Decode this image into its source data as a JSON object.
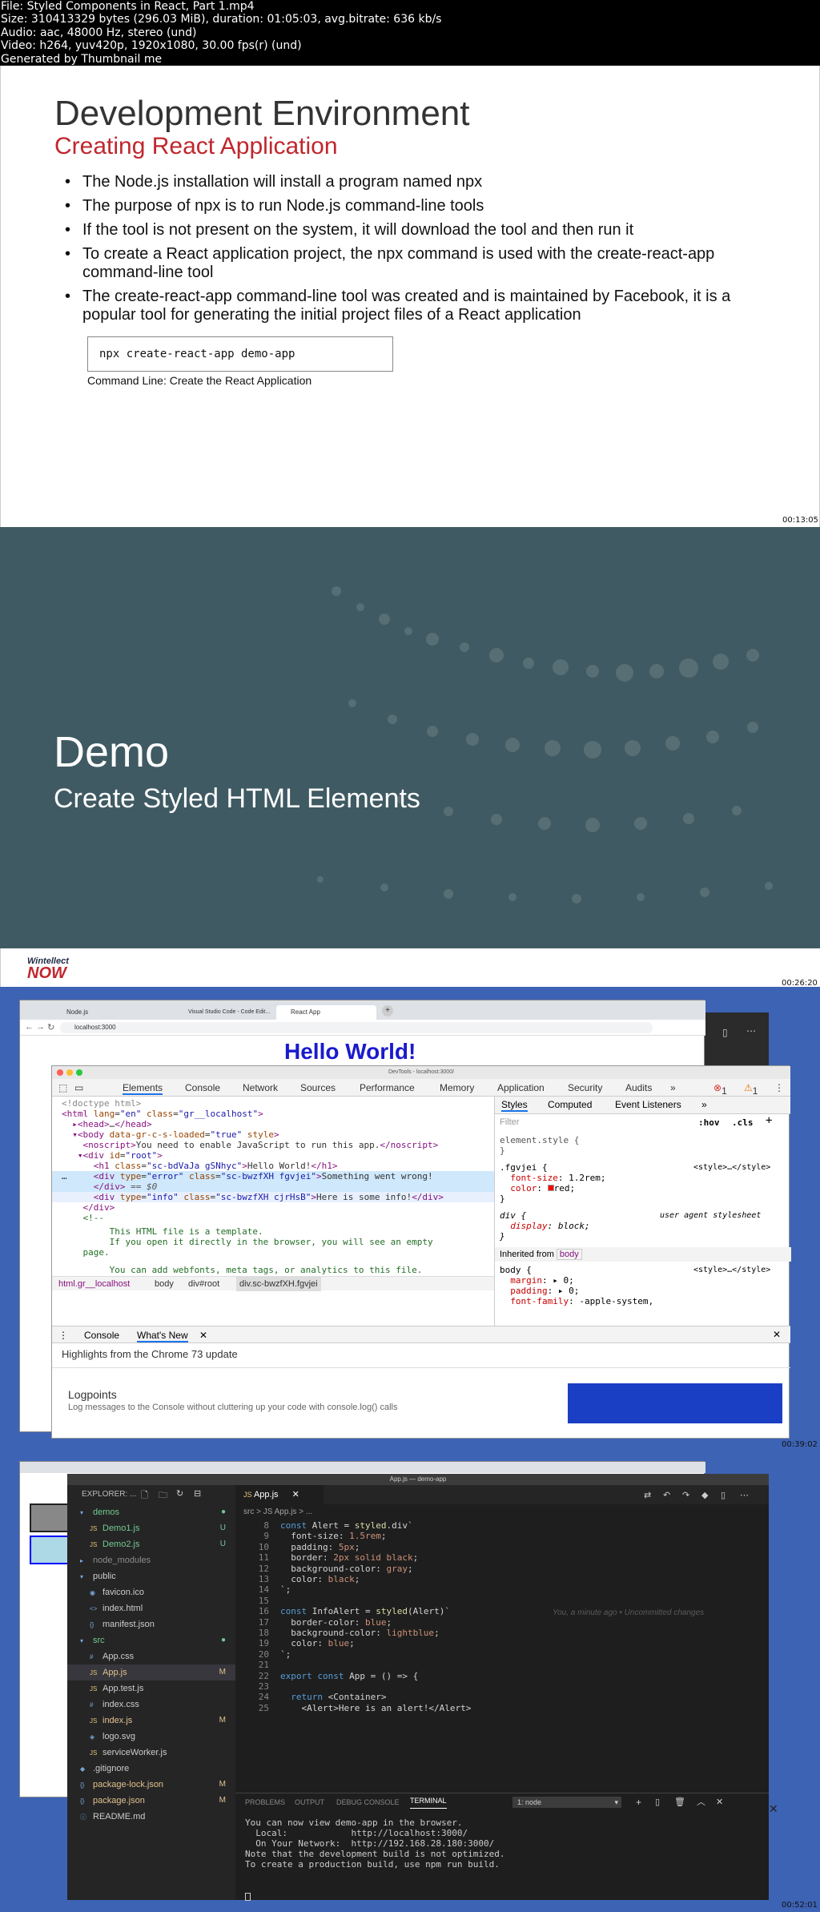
{
  "info": {
    "lines": [
      "File: Styled Components in React, Part 1.mp4",
      "Size: 310413329 bytes (296.03 MiB), duration: 01:05:03, avg.bitrate: 636 kb/s",
      "Audio: aac, 48000 Hz, stereo (und)",
      "Video: h264, yuv420p, 1920x1080, 30.00 fps(r) (und)",
      "Generated by Thumbnail me"
    ]
  },
  "slide1": {
    "title": "Development Environment",
    "subtitle": "Creating React Application",
    "bullets": [
      "The Node.js installation will install a program named npx",
      "The purpose of npx is to run Node.js command-line tools",
      "If the tool is not present on the system, it will download the tool and then run it",
      "To create a React application project, the npx command is used with the create-react-app command-line tool",
      "The create-react-app command-line tool was created and is maintained by Facebook, it is a popular tool for generating the initial project files of a React application"
    ],
    "code": "npx create-react-app demo-app",
    "caption": "Command Line: Create the React Application",
    "timestamp": "00:13:05"
  },
  "slide2": {
    "title": "Demo",
    "subtitle": "Create Styled HTML Elements",
    "brand_top": "Wintellect",
    "brand_bottom": "NOW",
    "timestamp": "00:26:20"
  },
  "frame3": {
    "tabs": [
      "Node.js",
      "Visual Studio Code - Code Edit...",
      "React App"
    ],
    "url": "localhost:3000",
    "page_heading": "Hello World!",
    "devtools_title": "DevTools - localhost:3000/",
    "dt_tabs": [
      "Elements",
      "Console",
      "Network",
      "Sources",
      "Performance",
      "Memory",
      "Application",
      "Security",
      "Audits",
      "»"
    ],
    "errors": "1",
    "warnings": "1",
    "styles_tabs": [
      "Styles",
      "Computed",
      "Event Listeners",
      "»"
    ],
    "filter_placeholder": "Filter",
    "hov": ":hov",
    "cls": ".cls",
    "breadcrumb": [
      "html.gr__localhost",
      "body",
      "div#root",
      "div.sc-bwzfXH.fgvjei"
    ],
    "drawer_tabs": [
      "Console",
      "What's New"
    ],
    "drawer_headline": "Highlights from the Chrome 73 update",
    "drawer_item": "Logpoints",
    "drawer_item_desc": "Log messages to the Console without cluttering up your code with console.log() calls",
    "timestamp": "00:39:02"
  },
  "frame4": {
    "window_title": "App.js — demo-app",
    "explorer_title": "EXPLORER: ...",
    "file_tab": "App.js",
    "breadcrumb": "src > JS App.js > ...",
    "tree": [
      {
        "name": "demos",
        "indent": 1,
        "type": "folder-open",
        "color": "#73c991",
        "badge": "●"
      },
      {
        "name": "Demo1.js",
        "indent": 2,
        "type": "js",
        "color": "#73c991",
        "badge": "U"
      },
      {
        "name": "Demo2.js",
        "indent": 2,
        "type": "js",
        "color": "#73c991",
        "badge": "U"
      },
      {
        "name": "node_modules",
        "indent": 1,
        "type": "folder",
        "color": "#8c8c8c",
        "badge": ""
      },
      {
        "name": "public",
        "indent": 1,
        "type": "folder-open",
        "color": "#cccccc",
        "badge": ""
      },
      {
        "name": "favicon.ico",
        "indent": 2,
        "type": "ico",
        "color": "#cccccc",
        "badge": ""
      },
      {
        "name": "index.html",
        "indent": 2,
        "type": "html",
        "color": "#cccccc",
        "badge": ""
      },
      {
        "name": "manifest.json",
        "indent": 2,
        "type": "json",
        "color": "#cccccc",
        "badge": ""
      },
      {
        "name": "src",
        "indent": 1,
        "type": "folder-open",
        "color": "#73c991",
        "badge": "●"
      },
      {
        "name": "App.css",
        "indent": 2,
        "type": "css",
        "color": "#cccccc",
        "badge": ""
      },
      {
        "name": "App.js",
        "indent": 2,
        "type": "js",
        "color": "#e2c08d",
        "badge": "M"
      },
      {
        "name": "App.test.js",
        "indent": 2,
        "type": "js",
        "color": "#cccccc",
        "badge": ""
      },
      {
        "name": "index.css",
        "indent": 2,
        "type": "css",
        "color": "#cccccc",
        "badge": ""
      },
      {
        "name": "index.js",
        "indent": 2,
        "type": "js",
        "color": "#e2c08d",
        "badge": "M"
      },
      {
        "name": "logo.svg",
        "indent": 2,
        "type": "svg",
        "color": "#cccccc",
        "badge": ""
      },
      {
        "name": "serviceWorker.js",
        "indent": 2,
        "type": "js",
        "color": "#cccccc",
        "badge": ""
      },
      {
        "name": ".gitignore",
        "indent": 1,
        "type": "git",
        "color": "#cccccc",
        "badge": ""
      },
      {
        "name": "package-lock.json",
        "indent": 1,
        "type": "json",
        "color": "#e2c08d",
        "badge": "M"
      },
      {
        "name": "package.json",
        "indent": 1,
        "type": "json",
        "color": "#e2c08d",
        "badge": "M"
      },
      {
        "name": "README.md",
        "indent": 1,
        "type": "md",
        "color": "#cccccc",
        "badge": ""
      }
    ],
    "code_lines": [
      {
        "n": "8",
        "t": "const Alert = styled.div`"
      },
      {
        "n": "9",
        "t": "  font-size: 1.5rem;"
      },
      {
        "n": "10",
        "t": "  padding: 5px;"
      },
      {
        "n": "11",
        "t": "  border: 2px solid black;"
      },
      {
        "n": "12",
        "t": "  background-color: gray;"
      },
      {
        "n": "13",
        "t": "  color: black;"
      },
      {
        "n": "14",
        "t": "`;"
      },
      {
        "n": "15",
        "t": ""
      },
      {
        "n": "16",
        "t": "const InfoAlert = styled(Alert)`"
      },
      {
        "n": "17",
        "t": "  border-color: blue;"
      },
      {
        "n": "18",
        "t": "  background-color: lightblue;"
      },
      {
        "n": "19",
        "t": "  color: blue;"
      },
      {
        "n": "20",
        "t": "`;"
      },
      {
        "n": "21",
        "t": ""
      },
      {
        "n": "22",
        "t": "export const App = () => {"
      },
      {
        "n": "23",
        "t": ""
      },
      {
        "n": "24",
        "t": "  return <Container>"
      },
      {
        "n": "25",
        "t": "    <Alert>Here is an alert!</Alert>"
      }
    ],
    "blame": "You, a minute ago • Uncommitted changes",
    "panel_tabs": [
      "PROBLEMS",
      "OUTPUT",
      "DEBUG CONSOLE",
      "TERMINAL"
    ],
    "terminal_select": "1: node",
    "terminal_lines": [
      "You can now view demo-app in the browser.",
      "",
      "  Local:            http://localhost:3000/",
      "  On Your Network:  http://192.168.28.180:3000/",
      "",
      "Note that the development build is not optimized.",
      "To create a production build, use npm run build."
    ],
    "timestamp": "00:52:01"
  }
}
